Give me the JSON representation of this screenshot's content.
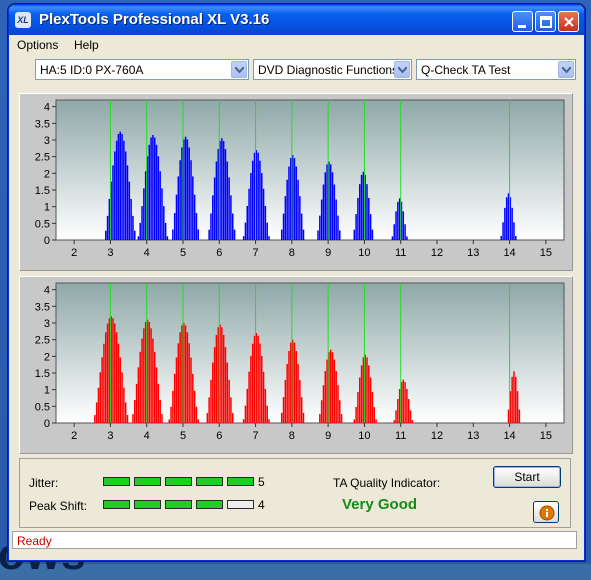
{
  "window": {
    "title": "PlexTools Professional XL V3.16",
    "icon_text": "XL"
  },
  "menu": [
    {
      "label": "Options"
    },
    {
      "label": "Help"
    }
  ],
  "toolbar": {
    "drive": "HA:5 ID:0  PX-760A",
    "category": "DVD Diagnostic Functions",
    "test": "Q-Check TA Test"
  },
  "chart_data": [
    {
      "type": "bar",
      "title": "",
      "xlabel": "",
      "ylabel": "",
      "color": "#0000ff",
      "xlim": [
        1.5,
        15.5
      ],
      "ylim": [
        0,
        4.2
      ],
      "x_ticks": [
        "2",
        "3",
        "4",
        "5",
        "6",
        "7",
        "8",
        "9",
        "10",
        "11",
        "12",
        "13",
        "14",
        "15"
      ],
      "y_ticks": [
        "0",
        "0.5",
        "1",
        "1.5",
        "2",
        "2.5",
        "3",
        "3.5",
        "4"
      ],
      "grid": "vertical lines at x ticks",
      "markers": [
        3,
        4,
        5,
        6,
        7,
        8,
        9,
        10,
        11,
        14
      ],
      "peaks": [
        {
          "center": 3.25,
          "height": 3.25,
          "width": 0.9
        },
        {
          "center": 4.15,
          "height": 3.15,
          "width": 0.85
        },
        {
          "center": 5.05,
          "height": 3.1,
          "width": 0.8
        },
        {
          "center": 6.05,
          "height": 3.05,
          "width": 0.8
        },
        {
          "center": 7.0,
          "height": 2.7,
          "width": 0.75
        },
        {
          "center": 8.0,
          "height": 2.55,
          "width": 0.7
        },
        {
          "center": 9.0,
          "height": 2.35,
          "width": 0.7
        },
        {
          "center": 9.95,
          "height": 2.05,
          "width": 0.6
        },
        {
          "center": 10.95,
          "height": 1.25,
          "width": 0.45
        },
        {
          "center": 13.95,
          "height": 1.4,
          "width": 0.45
        }
      ]
    },
    {
      "type": "bar",
      "title": "",
      "xlabel": "",
      "ylabel": "",
      "color": "#ff0000",
      "xlim": [
        1.5,
        15.5
      ],
      "ylim": [
        0,
        4.2
      ],
      "x_ticks": [
        "2",
        "3",
        "4",
        "5",
        "6",
        "7",
        "8",
        "9",
        "10",
        "11",
        "12",
        "13",
        "14",
        "15"
      ],
      "y_ticks": [
        "0",
        "0.5",
        "1",
        "1.5",
        "2",
        "2.5",
        "3",
        "3.5",
        "4"
      ],
      "grid": "vertical lines at x ticks",
      "markers": [
        3,
        4,
        5,
        6,
        7,
        8,
        9,
        10,
        11,
        14
      ],
      "peaks": [
        {
          "center": 3.0,
          "height": 3.2,
          "width": 1.0
        },
        {
          "center": 4.0,
          "height": 3.1,
          "width": 0.9
        },
        {
          "center": 5.0,
          "height": 3.0,
          "width": 0.85
        },
        {
          "center": 6.0,
          "height": 2.95,
          "width": 0.8
        },
        {
          "center": 7.0,
          "height": 2.7,
          "width": 0.75
        },
        {
          "center": 8.0,
          "height": 2.5,
          "width": 0.7
        },
        {
          "center": 9.05,
          "height": 2.2,
          "width": 0.7
        },
        {
          "center": 10.0,
          "height": 2.05,
          "width": 0.65
        },
        {
          "center": 11.05,
          "height": 1.3,
          "width": 0.55
        },
        {
          "center": 14.1,
          "height": 1.55,
          "width": 0.4
        }
      ]
    }
  ],
  "results": {
    "jitter_label": "Jitter:",
    "jitter_value": "5",
    "jitter_level": 5,
    "peakshift_label": "Peak Shift:",
    "peakshift_value": "4",
    "peakshift_level": 4,
    "meter_max": 5,
    "ta_label": "TA Quality Indicator:",
    "ta_value": "Very Good"
  },
  "buttons": {
    "start": "Start"
  },
  "status": {
    "text": "Ready"
  },
  "desktop": {
    "wallpaper_text": "ows"
  }
}
